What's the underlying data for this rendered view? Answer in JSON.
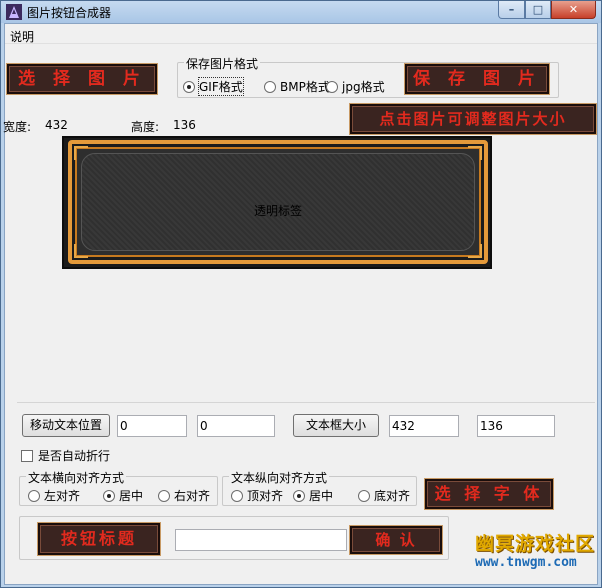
{
  "window": {
    "title": "图片按钮合成器",
    "controls": {
      "minimize": "–",
      "maximize": "□",
      "close": "✕"
    }
  },
  "menu": {
    "items": [
      {
        "label": "说明"
      }
    ]
  },
  "top": {
    "select_image_label": "选 择 图 片",
    "format_group": {
      "legend": "保存图片格式",
      "options": [
        {
          "label": "GIF格式",
          "selected": true
        },
        {
          "label": "BMP格式",
          "selected": false
        },
        {
          "label": "jpg格式",
          "selected": false
        }
      ]
    },
    "save_image_label": "保 存 图 片",
    "width_label": "宽度:",
    "width_value": "432",
    "height_label": "高度:",
    "height_value": "136",
    "resize_hint": "点击图片可调整图片大小"
  },
  "preview": {
    "label": "透明标签"
  },
  "controls": {
    "move_text_button": "移动文本位置",
    "move_x": "0",
    "move_y": "0",
    "textbox_size_button": "文本框大小",
    "textbox_w": "432",
    "textbox_h": "136",
    "wrap_label": "是否自动折行",
    "h_align": {
      "legend": "文本横向对齐方式",
      "options": [
        {
          "label": "左对齐",
          "selected": false
        },
        {
          "label": "居中",
          "selected": true
        },
        {
          "label": "右对齐",
          "selected": false
        }
      ]
    },
    "v_align": {
      "legend": "文本纵向对齐方式",
      "options": [
        {
          "label": "顶对齐",
          "selected": false
        },
        {
          "label": "居中",
          "selected": true
        },
        {
          "label": "底对齐",
          "selected": false
        }
      ]
    },
    "select_font_label": "选 择 字 体",
    "button_title_label": "按钮标题",
    "title_input_value": "",
    "confirm_label": "确   认"
  },
  "watermark": {
    "name": "幽冥游戏社区",
    "url": "www.tnwgm.com"
  },
  "colors": {
    "accent_red": "#e22a1e",
    "frame_gold": "#e59a3a",
    "watermark_gold": "#e0a800",
    "watermark_blue": "#1e6bb5"
  }
}
